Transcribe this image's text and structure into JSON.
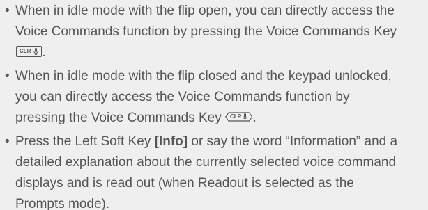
{
  "bullet_symbol": "•",
  "items": [
    {
      "lines": [
        "When in idle mode with the flip open, you can directly access the",
        "Voice Commands function by pressing the Voice Commands Key"
      ],
      "key_label": "CLR",
      "key_suffix": "."
    },
    {
      "lines": [
        "When in idle mode with the flip closed and the keypad unlocked,",
        "you can directly access the Voice Commands function by"
      ],
      "last_line_prefix": "pressing the Voice Commands Key ",
      "key_label": "CLR",
      "key_suffix": "."
    },
    {
      "line1_prefix": "Press the Left Soft Key ",
      "line1_bold": "[Info]",
      "line1_suffix": " or say the word “Information” and a",
      "lines": [
        "detailed explanation about the currently selected voice command",
        "displays and is read out (when Readout is selected as the",
        "Prompts mode)."
      ]
    }
  ]
}
